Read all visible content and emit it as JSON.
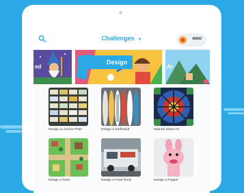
{
  "header": {
    "title": "Challenges",
    "coins": "45600"
  },
  "carousel": {
    "left_label": "ed",
    "center_label": "Design",
    "right_label": "Ar"
  },
  "challenges": [
    {
      "label": "Design a Licence Plate"
    },
    {
      "label": "Design a Surfboard"
    },
    {
      "label": "Stained Glass Art"
    },
    {
      "label": "Design a Town"
    },
    {
      "label": "Design a Food Truck"
    },
    {
      "label": "Design a Puppet"
    }
  ],
  "colors": {
    "background": "#2aa9e6",
    "accent": "#2aa9e6"
  }
}
